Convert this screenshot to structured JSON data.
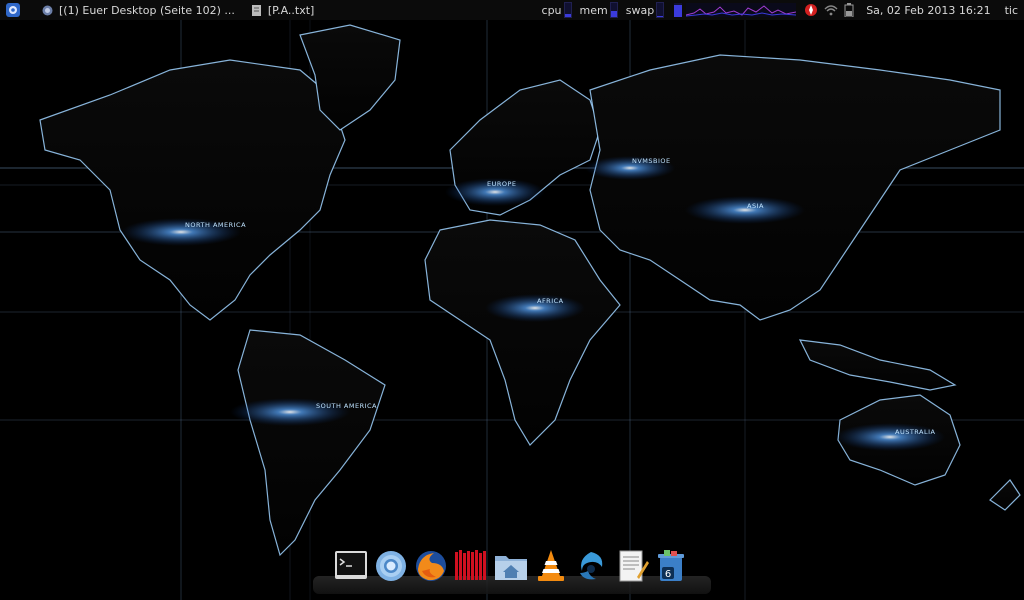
{
  "topbar": {
    "tasks": [
      {
        "label": "[(1) Euer Desktop (Seite 102) ...",
        "icon": "firefox-icon"
      },
      {
        "label": "[P.A..txt]",
        "icon": "text-editor-icon"
      }
    ],
    "meters": {
      "cpu": "cpu",
      "mem": "mem",
      "swap": "swap"
    },
    "meter_levels": {
      "cpu": 0.2,
      "mem": 0.45,
      "swap": 0.05
    },
    "clock": "Sa, 02 Feb 2013 16:21",
    "user": "tic"
  },
  "map_labels": {
    "north_america": "NORTH AMERICA",
    "south_america": "SOUTH AMERICA",
    "europe": "EUROPE",
    "africa": "AFRICA",
    "asia": "ASIA",
    "australia": "AUSTRALIA",
    "russia": "NVMSBIOE"
  },
  "dock": {
    "items": [
      "terminal",
      "chromium",
      "firefox",
      "red-app",
      "home-folder",
      "vlc",
      "opera",
      "text-editor",
      "trash"
    ],
    "trash_badge": "6"
  },
  "colors": {
    "accent": "#3b7bff",
    "panel": "#0b0b0b",
    "map_outline": "#9fd2ff"
  }
}
